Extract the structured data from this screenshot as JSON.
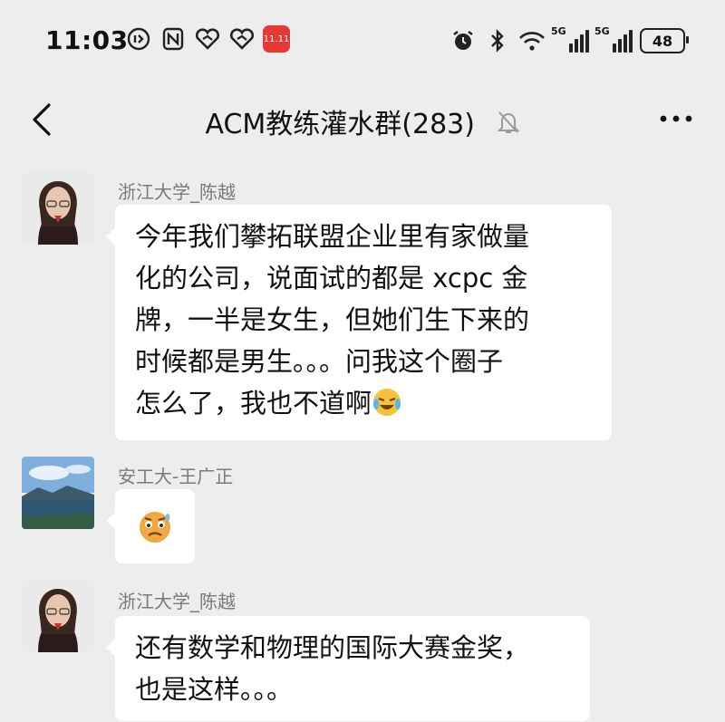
{
  "status_bar": {
    "time": "11:03",
    "app_badge_text": "11.11",
    "signal_1_label": "5G",
    "signal_2_label": "5G",
    "battery_level": "48"
  },
  "header": {
    "title": "ACM教练灌水群(283)"
  },
  "messages": [
    {
      "sender": "浙江大学_陈越",
      "lines": [
        "今年我们攀拓联盟企业里有家做量",
        "化的公司，说面试的都是 xcpc 金",
        "牌，一半是女生，但她们生下来的",
        "时候都是男生。。。问我这个圈子",
        "怎么了，我也不道啊"
      ]
    },
    {
      "sender": "安工大-王广正",
      "sticker": "nervous-face-emoji"
    },
    {
      "sender": "浙江大学_陈越",
      "lines": [
        "还有数学和物理的国际大赛金奖，",
        "也是这样。。。"
      ]
    }
  ],
  "colors": {
    "background": "#ededed",
    "bubble": "#ffffff",
    "sender_text": "#7a7a7a"
  }
}
